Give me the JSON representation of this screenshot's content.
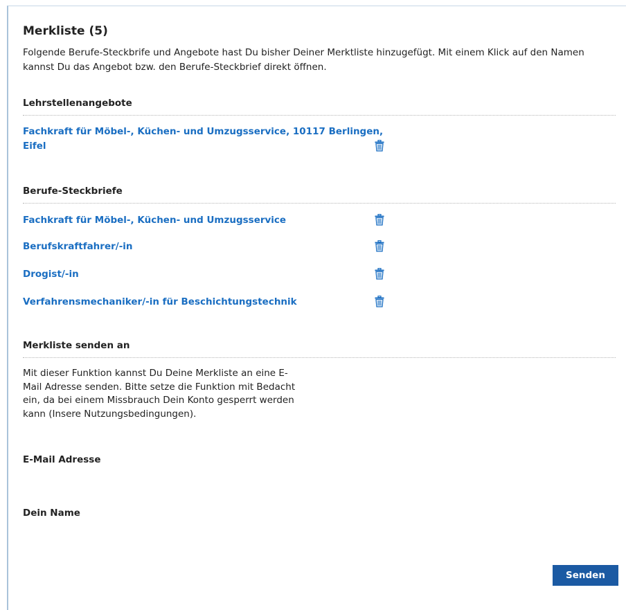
{
  "header": {
    "title": "Merkliste (5)",
    "intro": "Folgende Berufe-Steckbrife und Angebote hast Du bisher Deiner Merktliste hinzugefügt. Mit einem Klick auf den Namen kannst Du das Angebot bzw. den Berufe-Steckbrief direkt öffnen."
  },
  "apprenticeships": {
    "heading": "Lehrstellenangebote",
    "items": [
      {
        "label": "Fachkraft für Möbel-, Küchen- und Umzugsservice, 10117 Berlingen, Eifel"
      }
    ]
  },
  "profiles": {
    "heading": "Berufe-Steckbriefe",
    "items": [
      {
        "label": "Fachkraft für Möbel-, Küchen- und Umzugsservice"
      },
      {
        "label": "Berufskraftfahrer/-in"
      },
      {
        "label": "Drogist/-in"
      },
      {
        "label": "Verfahrensmechaniker/-in für Beschichtungstechnik"
      }
    ]
  },
  "send": {
    "heading": "Merkliste senden an",
    "description": "Mit dieser Funktion kannst Du Deine Merkliste an eine E-Mail Adresse senden. Bitte setze die Funktion mit Bedacht ein, da bei einem Missbrauch Dein Konto gesperrt werden kann (Insere Nutzungsbedingungen).",
    "email_label": "E-Mail Adresse",
    "email_value": "",
    "name_label": "Dein Name",
    "name_value": "",
    "button_label": "Senden"
  },
  "colors": {
    "link": "#1a6ec2",
    "button": "#1b5aa3",
    "frame": "#a9c3da"
  },
  "icons": {
    "delete": "trash-icon"
  }
}
